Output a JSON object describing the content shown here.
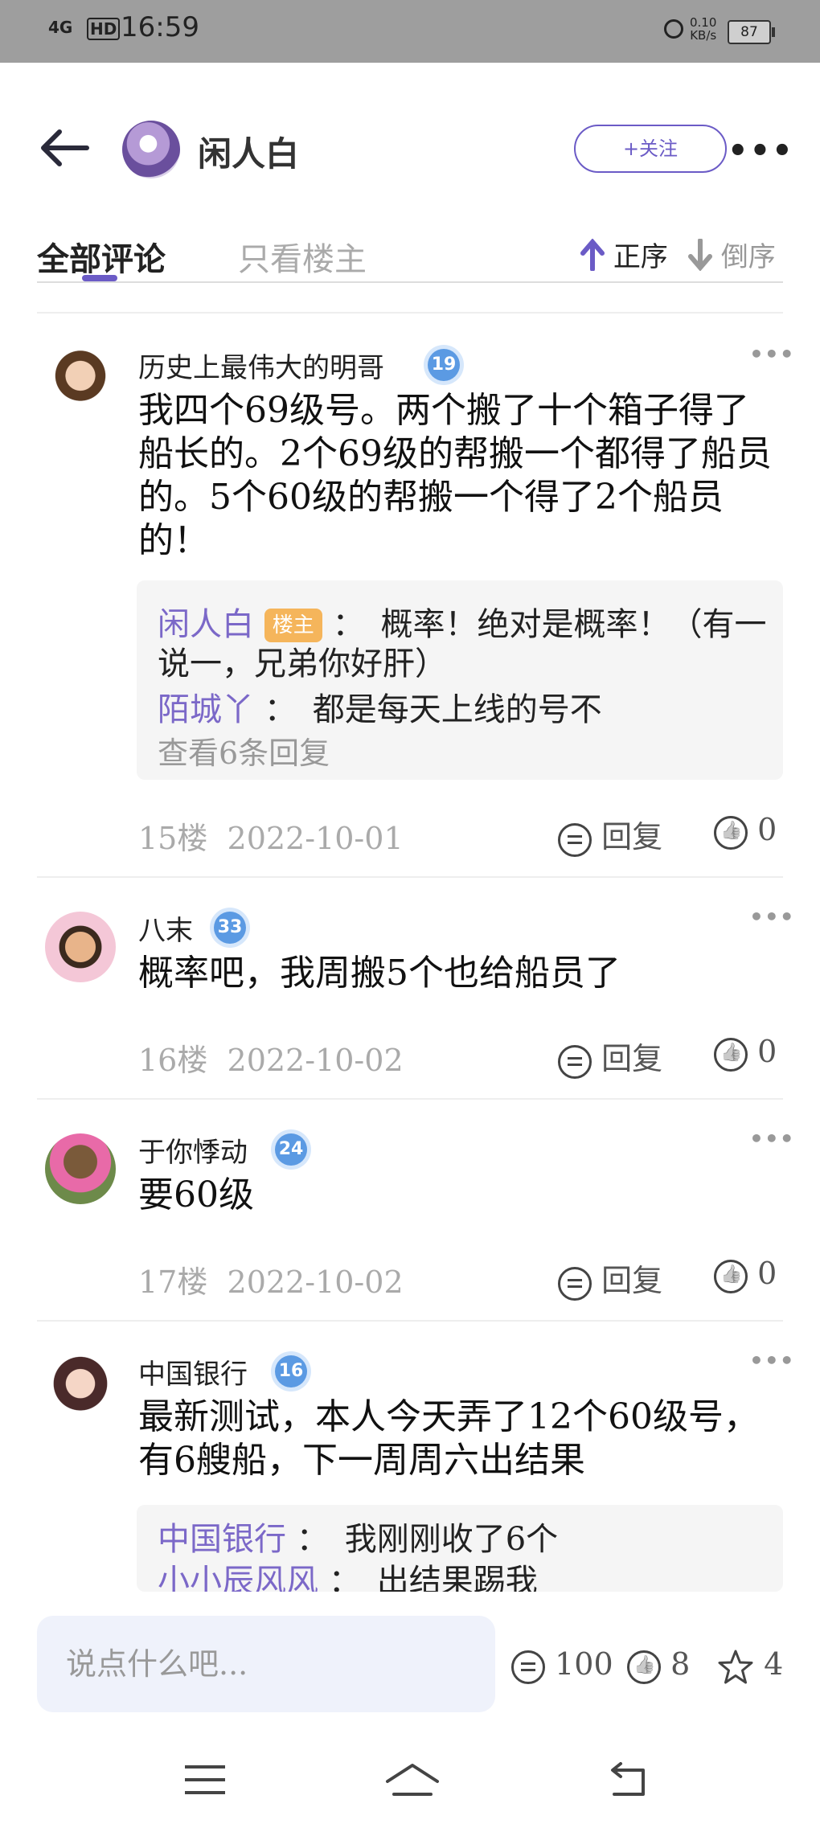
{
  "status_bar": {
    "network": "4G",
    "hd": "HD",
    "time": "16:59",
    "speed": "0.10\nKB/s",
    "battery": "87"
  },
  "header": {
    "title": "闲人白",
    "follow_label": "+关注",
    "more": "•••"
  },
  "tabs": {
    "all": "全部评论",
    "host_only": "只看楼主",
    "asc": "正序",
    "desc": "倒序"
  },
  "comments": [
    {
      "user": "历史上最伟大的明哥",
      "level": "19",
      "text": "我四个69级号。两个搬了十个箱子得了船长的。2个69级的帮搬一个都得了船员的。5个60级的帮搬一个得了2个船员的！",
      "replies": [
        {
          "name": "闲人白",
          "tag": "楼主",
          "text": "：　概率！绝对是概率！（有一说一，兄弟你好肝）"
        },
        {
          "name": "陌城丫",
          "text": "：　都是每天上线的号不"
        }
      ],
      "view_more": "查看6条回复",
      "floor": "15楼",
      "date": "2022-10-01",
      "reply_label": "回复",
      "likes": "0"
    },
    {
      "user": "八末",
      "level": "33",
      "text": "概率吧，我周搬5个也给船员了",
      "floor": "16楼",
      "date": "2022-10-02",
      "reply_label": "回复",
      "likes": "0"
    },
    {
      "user": "于你悸动",
      "level": "24",
      "text": "要60级",
      "floor": "17楼",
      "date": "2022-10-02",
      "reply_label": "回复",
      "likes": "0"
    },
    {
      "user": "中国银行",
      "level": "16",
      "text": "最新测试，本人今天弄了12个60级号，有6艘船，下一周周六出结果",
      "replies": [
        {
          "name": "中国银行",
          "text": "：　我刚刚收了6个"
        },
        {
          "name": "小小辰风风",
          "text": "：　出结果踢我"
        }
      ]
    }
  ],
  "bottom": {
    "placeholder": "说点什么吧...",
    "comments_count": "100",
    "likes_count": "8",
    "favorites_count": "4"
  }
}
